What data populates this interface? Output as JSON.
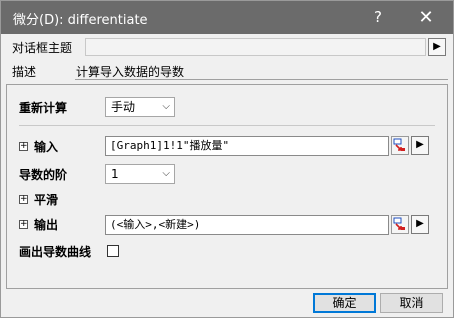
{
  "window": {
    "title": "微分(D): differentiate",
    "help_label": "?",
    "close_label": "✕"
  },
  "theme": {
    "label": "对话框主题",
    "value": ""
  },
  "description": {
    "label": "描述",
    "value": "计算导入数据的导数"
  },
  "recalc": {
    "label": "重新计算",
    "value": "手动"
  },
  "input": {
    "label": "输入",
    "value": "[Graph1]1!1\"播放量\""
  },
  "order": {
    "label": "导数的阶",
    "value": "1"
  },
  "smooth": {
    "label": "平滑"
  },
  "output": {
    "label": "输出",
    "value": "(<输入>,<新建>)"
  },
  "plot_curve": {
    "label": "画出导数曲线",
    "checked": false
  },
  "buttons": {
    "ok": "确定",
    "cancel": "取消"
  },
  "icons": {
    "expand": "plus-box-icon",
    "arrow": "triangle-right-icon",
    "picker": "range-picker-icon",
    "dropdown": "chevron-down-icon"
  }
}
